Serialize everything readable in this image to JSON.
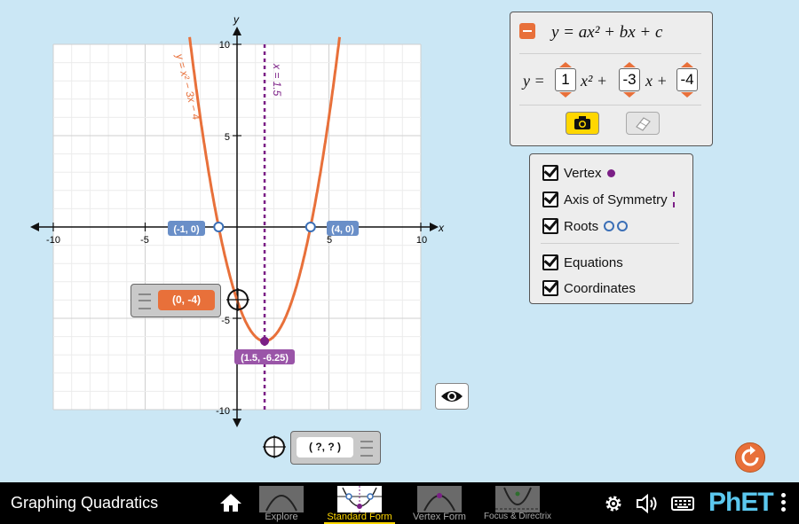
{
  "graph": {
    "x_tick_labels": [
      "-10",
      "-5",
      "5",
      "10"
    ],
    "y_tick_labels": [
      "10",
      "5",
      "-5",
      "-10"
    ],
    "x_axis_label": "x",
    "y_axis_label": "y",
    "curve_label": "y = x² − 3x − 4",
    "axis_label": "x = 1.5",
    "root_left_label": "(-1, 0)",
    "root_right_label": "(4, 0)",
    "vertex_label": "(1.5, -6.25)",
    "curve_color": "#e8703a",
    "axis_color": "#7b1f86"
  },
  "point_tool_top": {
    "value": "(0, -4)"
  },
  "point_tool_bottom": {
    "value": "( ?, ? )"
  },
  "equation_panel": {
    "title": "y = ax² + bx + c",
    "y_equals": "y =",
    "a": "1",
    "x2_plus": "x² +",
    "b": "-3",
    "x_plus": "x +",
    "c": "-4"
  },
  "checkboxes": {
    "vertex": "Vertex",
    "axis": "Axis of Symmetry",
    "roots": "Roots",
    "equations": "Equations",
    "coordinates": "Coordinates"
  },
  "navbar": {
    "title": "Graphing Quadratics",
    "screens": [
      "Explore",
      "Standard Form",
      "Vertex Form",
      "Focus & Directrix"
    ],
    "active_screen": "Standard Form",
    "brand": "PhET"
  },
  "colors": {
    "accent": "#e8703a",
    "vertex": "#7b1f86",
    "roots": "#3b6fb6",
    "active_nav": "#ffd700"
  },
  "chart_data": {
    "type": "line",
    "title": "",
    "xlabel": "x",
    "ylabel": "y",
    "xlim": [
      -10,
      10
    ],
    "ylim": [
      -10,
      10
    ],
    "grid": true,
    "series": [
      {
        "name": "y = x² − 3x − 4",
        "function": "x^2 - 3x - 4"
      },
      {
        "name": "x = 1.5",
        "vertical_line_x": 1.5
      }
    ],
    "points": [
      {
        "label": "(-1, 0)",
        "x": -1,
        "y": 0,
        "kind": "root"
      },
      {
        "label": "(4, 0)",
        "x": 4,
        "y": 0,
        "kind": "root"
      },
      {
        "label": "(1.5, -6.25)",
        "x": 1.5,
        "y": -6.25,
        "kind": "vertex"
      }
    ]
  }
}
